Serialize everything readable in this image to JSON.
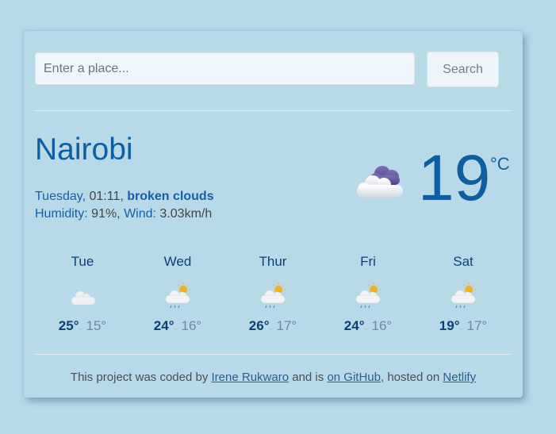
{
  "search": {
    "placeholder": "Enter a place...",
    "value": "",
    "button_label": "Search"
  },
  "current": {
    "city": "Nairobi",
    "day": "Tuesday,",
    "time": "01:11,",
    "description": "broken clouds",
    "humidity_label": "Humidity:",
    "humidity_value": "91%,",
    "wind_label": "Wind:",
    "wind_value": "3.03km/h",
    "temperature": "19",
    "unit": "°C",
    "icon": "broken-clouds-icon"
  },
  "forecast": [
    {
      "day": "Tue",
      "max": "25°",
      "min": "15°",
      "icon": "cloud-icon"
    },
    {
      "day": "Wed",
      "max": "24°",
      "min": "16°",
      "icon": "rain-sun-icon"
    },
    {
      "day": "Thur",
      "max": "26°",
      "min": "17°",
      "icon": "rain-sun-icon"
    },
    {
      "day": "Fri",
      "max": "24°",
      "min": "16°",
      "icon": "rain-sun-icon"
    },
    {
      "day": "Sat",
      "max": "19°",
      "min": "17°",
      "icon": "rain-sun-icon"
    }
  ],
  "footer": {
    "text1": "This project was coded by ",
    "author_link": "Irene Rukwaro",
    "text2": " and is ",
    "github_link": "on GitHub",
    "text3": ", hosted on ",
    "netlify_link": "Netlify"
  },
  "colors": {
    "background": "#b8d9e7",
    "primary_blue": "#0d5ea3",
    "dark_navy": "#0f3f72",
    "muted_blue": "#6e88a8"
  }
}
